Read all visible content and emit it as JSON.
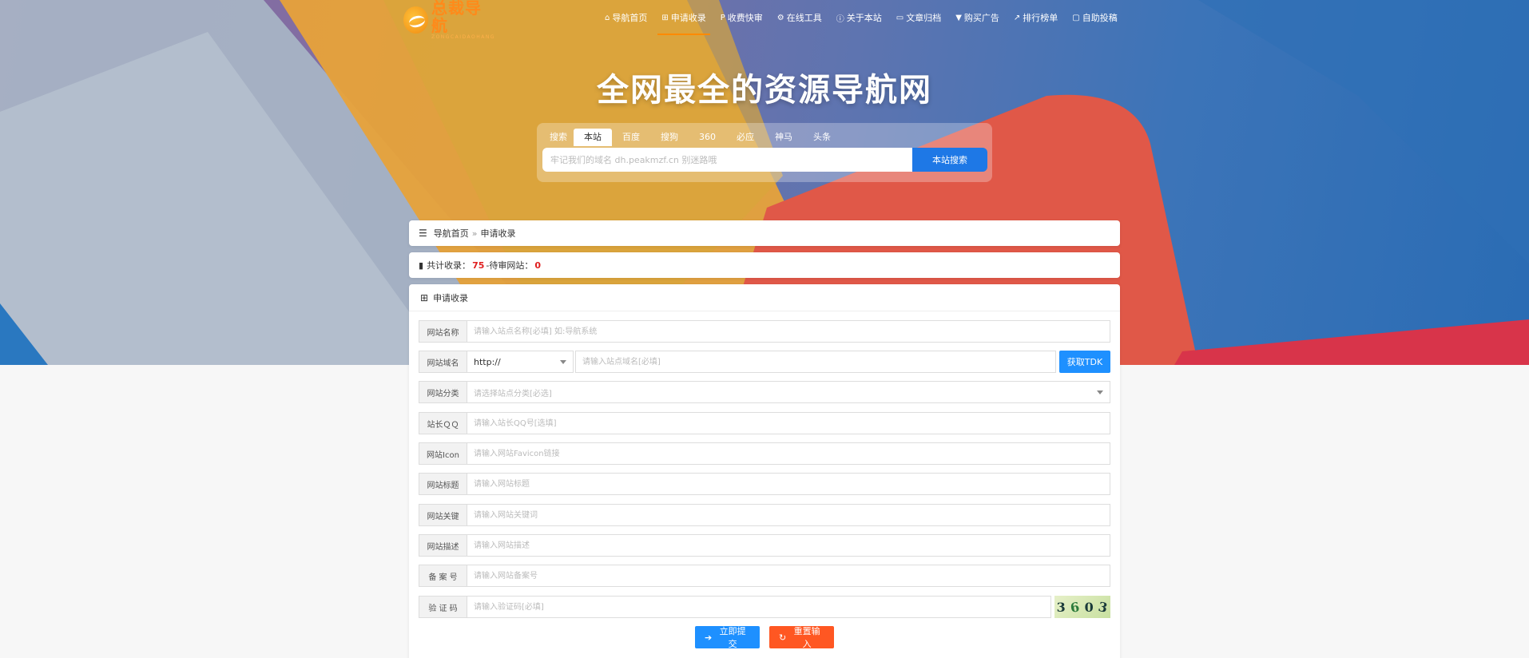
{
  "logo": {
    "title": "总裁导航",
    "subtitle": "ZONGCAIDAOHANG"
  },
  "nav": [
    {
      "icon": "home-icon",
      "glyph": "⌂",
      "label": "导航首页"
    },
    {
      "icon": "plus-square-icon",
      "glyph": "⊞",
      "label": "申请收录",
      "active": true
    },
    {
      "icon": "paypal-icon",
      "glyph": "P",
      "label": "收费快审"
    },
    {
      "icon": "gears-icon",
      "glyph": "⚙",
      "label": "在线工具"
    },
    {
      "icon": "info-icon",
      "glyph": "ⓘ",
      "label": "关于本站"
    },
    {
      "icon": "folder-open-icon",
      "glyph": "▭",
      "label": "文章归档"
    },
    {
      "icon": "cart-icon",
      "glyph": "▼",
      "label": "购买广告"
    },
    {
      "icon": "line-chart-icon",
      "glyph": "↗",
      "label": "排行榜单"
    },
    {
      "icon": "inbox-icon",
      "glyph": "▢",
      "label": "自助投稿"
    }
  ],
  "headline": "全网最全的资源导航网",
  "search": {
    "label": "搜索",
    "tabs": [
      "本站",
      "百度",
      "搜狗",
      "360",
      "必应",
      "神马",
      "头条"
    ],
    "active_tab": "本站",
    "placeholder": "牢记我们的域名 dh.peakmzf.cn 别迷路哦",
    "button": "本站搜索"
  },
  "breadcrumb": {
    "home": "导航首页",
    "separator": "»",
    "current": "申请收录"
  },
  "stats": {
    "total_label": "共计收录：",
    "total": "75",
    "dash": " - ",
    "pending_label": "待审网站：",
    "pending": "0"
  },
  "form": {
    "title": "申请收录",
    "fields": {
      "name": {
        "label": "网站名称",
        "placeholder": "请输入站点名称[必填] 如:导航系统"
      },
      "domain": {
        "label": "网站域名",
        "protocol": "http://",
        "placeholder": "请输入站点域名[必填]",
        "tdk_button": "获取TDK"
      },
      "category": {
        "label": "网站分类",
        "placeholder": "请选择站点分类[必选]"
      },
      "qq": {
        "label": "站长ＱＱ",
        "placeholder": "请输入站长QQ号[选填]"
      },
      "icon": {
        "label": "网站Icon",
        "placeholder": "请输入网站Favicon链接"
      },
      "title": {
        "label": "网站标题",
        "placeholder": "请输入网站标题"
      },
      "keywords": {
        "label": "网站关键",
        "placeholder": "请输入网站关键词"
      },
      "description": {
        "label": "网站描述",
        "placeholder": "请输入网站描述"
      },
      "icp": {
        "label": "备 案 号",
        "placeholder": "请输入网站备案号"
      },
      "captcha": {
        "label": "验 证 码",
        "placeholder": "请输入验证码[必填]",
        "chars": [
          "3",
          "6",
          "0",
          "3"
        ]
      }
    },
    "submit": "立即提交",
    "reset": "重置输入"
  },
  "colors": {
    "accent": "#1e90ff",
    "reset": "#ff5722",
    "nav_active": "#ff8a00",
    "count": "#e02020"
  }
}
